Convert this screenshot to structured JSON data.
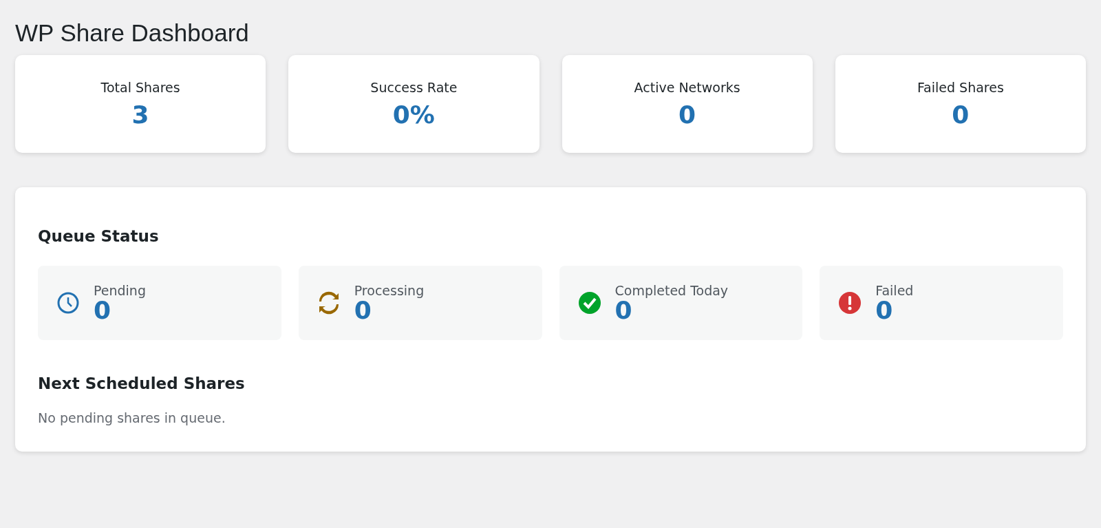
{
  "page_title": "WP Share Dashboard",
  "stats": [
    {
      "label": "Total Shares",
      "value": "3"
    },
    {
      "label": "Success Rate",
      "value": "0%"
    },
    {
      "label": "Active Networks",
      "value": "0"
    },
    {
      "label": "Failed Shares",
      "value": "0"
    }
  ],
  "queue_status": {
    "heading": "Queue Status",
    "items": [
      {
        "kind": "pending",
        "label": "Pending",
        "value": "0"
      },
      {
        "kind": "processing",
        "label": "Processing",
        "value": "0"
      },
      {
        "kind": "completed",
        "label": "Completed Today",
        "value": "0"
      },
      {
        "kind": "failed",
        "label": "Failed",
        "value": "0"
      }
    ]
  },
  "next_scheduled": {
    "heading": "Next Scheduled Shares",
    "empty_message": "No pending shares in queue."
  }
}
